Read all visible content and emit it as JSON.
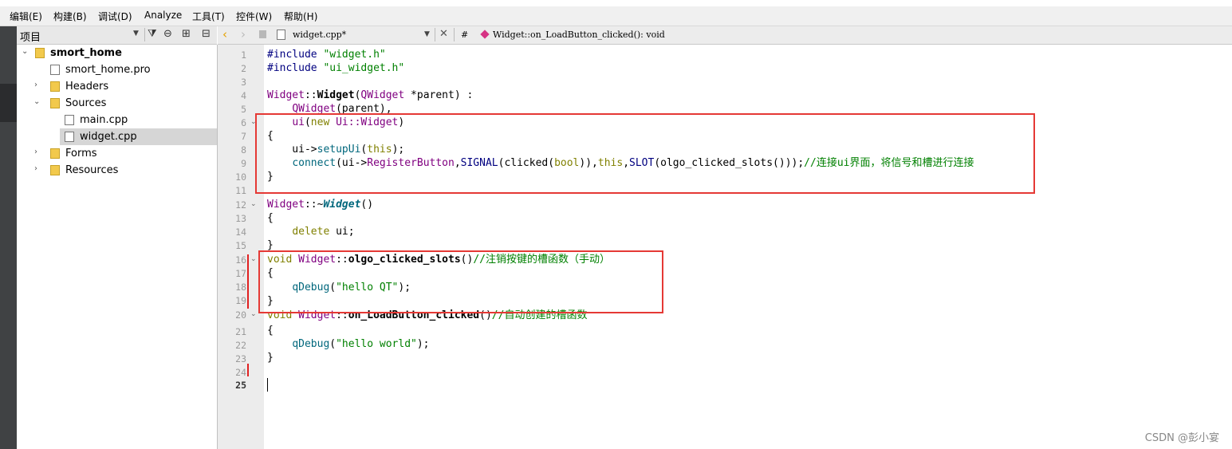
{
  "menubar": {
    "items": [
      "编辑(E)",
      "构建(B)",
      "调试(D)",
      "Analyze",
      "工具(T)",
      "控件(W)",
      "帮助(H)"
    ]
  },
  "project_panel": {
    "title": "项目",
    "tree": [
      {
        "label": "smort_home",
        "icon": "project-folder-icon",
        "bold": true,
        "expanded": true,
        "depth": 0
      },
      {
        "label": "smort_home.pro",
        "icon": "pro-file-icon",
        "depth": 1
      },
      {
        "label": "Headers",
        "icon": "headers-folder-icon",
        "expanded": false,
        "depth": 1
      },
      {
        "label": "Sources",
        "icon": "sources-folder-icon",
        "expanded": true,
        "depth": 1
      },
      {
        "label": "main.cpp",
        "icon": "cpp-file-icon",
        "depth": 2
      },
      {
        "label": "widget.cpp",
        "icon": "cpp-file-icon",
        "depth": 2,
        "selected": true
      },
      {
        "label": "Forms",
        "icon": "forms-folder-icon",
        "expanded": false,
        "depth": 1
      },
      {
        "label": "Resources",
        "icon": "resources-folder-icon",
        "expanded": false,
        "depth": 1
      }
    ]
  },
  "editor": {
    "file_tab": "widget.cpp*",
    "hash": "#",
    "symbol": "Widget::on_LoadButton_clicked(): void",
    "line_numbers": [
      "1",
      "2",
      "3",
      "4",
      "5",
      "6",
      "7",
      "8",
      "9",
      "10",
      "11",
      "12",
      "13",
      "14",
      "15",
      "16",
      "17",
      "18",
      "19",
      "20",
      "21",
      "22",
      "23",
      "24",
      "25"
    ],
    "current_line": "25",
    "code": {
      "l1_a": "#include ",
      "l1_b": "\"widget.h\"",
      "l2_a": "#include ",
      "l2_b": "\"ui_widget.h\"",
      "l4_a": "Widget",
      "l4_b": "::",
      "l4_c": "Widget",
      "l4_d": "(",
      "l4_e": "QWidget",
      "l4_f": " *parent) :",
      "l5_a": "    ",
      "l5_b": "QWidget",
      "l5_c": "(parent),",
      "l6_a": "    ",
      "l6_b": "ui",
      "l6_c": "(",
      "l6_d": "new",
      "l6_e": " Ui::Widget",
      "l6_f": ")",
      "l7": "{",
      "l8_a": "    ui->",
      "l8_b": "setupUi",
      "l8_c": "(",
      "l8_d": "this",
      "l8_e": ");",
      "l9_a": "    ",
      "l9_b": "connect",
      "l9_c": "(ui->",
      "l9_d": "RegisterButton",
      "l9_e": ",",
      "l9_f": "SIGNAL",
      "l9_g": "(clicked(",
      "l9_h": "bool",
      "l9_i": ")),",
      "l9_j": "this",
      "l9_k": ",",
      "l9_l": "SLOT",
      "l9_m": "(olgo_clicked_slots()));",
      "l9_n": "//连接ui界面，将信号和槽进行连接",
      "l10": "}",
      "l12_a": "Widget",
      "l12_b": "::~",
      "l12_c": "Widget",
      "l12_d": "()",
      "l13": "{",
      "l14_a": "    ",
      "l14_b": "delete",
      "l14_c": " ui;",
      "l15": "}",
      "l16_a": "void",
      "l16_b": " ",
      "l16_c": "Widget",
      "l16_d": "::",
      "l16_e": "olgo_clicked_slots",
      "l16_f": "()",
      "l16_g": "//注销按键的槽函数（手动）",
      "l17": "{",
      "l18_a": "    ",
      "l18_b": "qDebug",
      "l18_c": "(",
      "l18_d": "\"hello QT\"",
      "l18_e": ");",
      "l19": "}",
      "l20_a": "void",
      "l20_b": " ",
      "l20_c": "Widget",
      "l20_d": "::",
      "l20_e": "on_LoadButton_clicked",
      "l20_f": "()",
      "l20_g": "//自动创建的槽函数",
      "l21": "{",
      "l22_a": "    ",
      "l22_b": "qDebug",
      "l22_c": "(",
      "l22_d": "\"hello world\"",
      "l22_e": ");",
      "l23": "}"
    }
  },
  "watermark": "CSDN @彭小宴",
  "colors": {
    "highlight_box": "#e53935",
    "keyword": "#808000",
    "class": "#800080",
    "string": "#008000",
    "comment": "#008000"
  }
}
